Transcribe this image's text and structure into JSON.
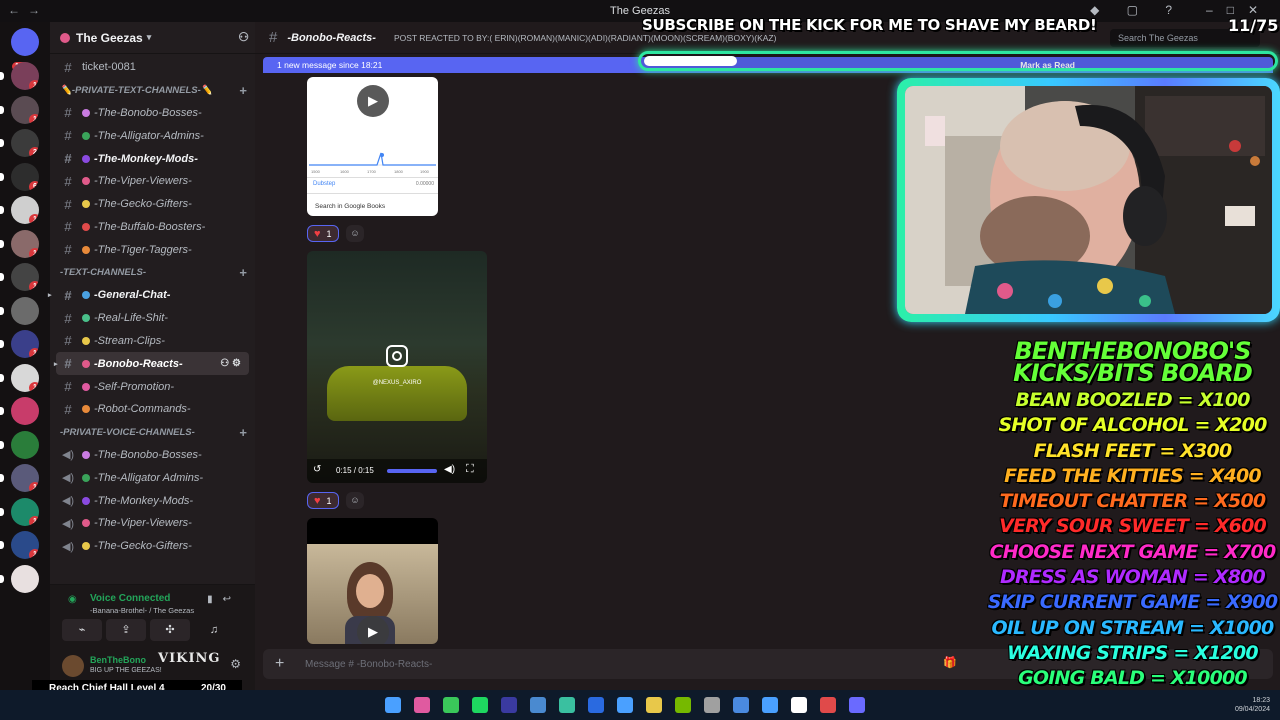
{
  "window": {
    "title": "The Geezas"
  },
  "rail": {
    "home_badge": "116",
    "servers": [
      {
        "color": "#7a3f5a",
        "badge": "1"
      },
      {
        "color": "#5a4b52",
        "badge": "1"
      },
      {
        "color": "#3b3b3b",
        "badge": "2"
      },
      {
        "color": "#2d2d2d",
        "badge": "6"
      },
      {
        "color": "#cfcfcf",
        "badge": "1"
      },
      {
        "color": "#8a6a6a",
        "badge": "1"
      },
      {
        "color": "#444444",
        "badge": "1"
      },
      {
        "color": "#6b6b6b",
        "badge": ""
      },
      {
        "color": "#3a3f8a",
        "badge": "1"
      },
      {
        "color": "#d8d8d8",
        "badge": "1"
      },
      {
        "color": "#c83c6a",
        "badge": ""
      },
      {
        "color": "#2a7d3a",
        "badge": ""
      },
      {
        "color": "#5a5a7a",
        "badge": "1"
      },
      {
        "color": "#1c8a6a",
        "badge": "1"
      },
      {
        "color": "#2a4a8a",
        "badge": "1"
      },
      {
        "color": "#e8e0e0",
        "badge": ""
      }
    ]
  },
  "sidebar": {
    "guild_name": "The Geezas",
    "items": [
      {
        "kind": "text",
        "label": "ticket-0081",
        "emoji": "",
        "bold": false,
        "italic_off": true
      },
      {
        "kind": "cat",
        "label": "✏️-PRIVATE-TEXT-CHANNELS-✏️"
      },
      {
        "kind": "text",
        "label": "-The-Bonobo-Bosses-",
        "emoji": "#c97be0"
      },
      {
        "kind": "text",
        "label": "-The-Alligator-Admins-",
        "emoji": "#3aa35a"
      },
      {
        "kind": "text",
        "label": "-The-Monkey-Mods-",
        "emoji": "#8a4ae0",
        "bold": true
      },
      {
        "kind": "text",
        "label": "-The-Viper-Viewers-",
        "emoji": "#e05a8a"
      },
      {
        "kind": "text",
        "label": "-The-Gecko-Gifters-",
        "emoji": "#e8c84a"
      },
      {
        "kind": "text",
        "label": "-The-Buffalo-Boosters-",
        "emoji": "#e04a4a"
      },
      {
        "kind": "text",
        "label": "-The-Tiger-Taggers-",
        "emoji": "#e88a3a"
      },
      {
        "kind": "cat",
        "label": "-TEXT-CHANNELS-"
      },
      {
        "kind": "text",
        "label": "-General-Chat-",
        "emoji": "#4aa0e0",
        "bold": true,
        "arrow": true
      },
      {
        "kind": "text",
        "label": "-Real-Life-Shit-",
        "emoji": "#4ac08a"
      },
      {
        "kind": "text",
        "label": "-Stream-Clips-",
        "emoji": "#e8c84a"
      },
      {
        "kind": "active",
        "label": "-Bonobo-Reacts-",
        "emoji": "#e05a8a",
        "arrow": true
      },
      {
        "kind": "text",
        "label": "-Self-Promotion-",
        "emoji": "#e05aa0"
      },
      {
        "kind": "text",
        "label": "-Robot-Commands-",
        "emoji": "#e88a3a"
      },
      {
        "kind": "cat",
        "label": "-PRIVATE-VOICE-CHANNELS-"
      },
      {
        "kind": "voice",
        "label": "-The-Bonobo-Bosses-",
        "emoji": "#c97be0"
      },
      {
        "kind": "voice",
        "label": "-The-Alligator Admins-",
        "emoji": "#3aa35a"
      },
      {
        "kind": "voice",
        "label": "-The-Monkey-Mods-",
        "emoji": "#8a4ae0"
      },
      {
        "kind": "voice",
        "label": "-The-Viper-Viewers-",
        "emoji": "#e05a8a"
      },
      {
        "kind": "voice",
        "label": "-The-Gecko-Gifters-",
        "emoji": "#e8c84a"
      }
    ],
    "voice": {
      "title": "Voice Connected",
      "subtitle": "-Banana-Brothel- / The Geezas"
    },
    "user": {
      "name": "BenTheBono",
      "status": "BIG UP THE GEEZAS!",
      "logo": "VIKING"
    }
  },
  "goal": {
    "label": "Reach Chief Hall Level 4",
    "count": "20/30",
    "progress": 0.6667
  },
  "chat": {
    "channel": "-Bonobo-Reacts-",
    "topic": "POST REACTED TO BY:( ERIN)(ROMAN)(MANIC)(ADI)(RADIANT)(MOON)(SCREAM)(BOXY)(KAZ)",
    "search_placeholder": "Search The Geezas",
    "new_messages": "1 new message since 18:21",
    "mark_read": "Mark as Read",
    "input_placeholder": "Message # -Bonobo-Reacts-",
    "attachments": {
      "books": {
        "ticks": [
          "1500",
          "1600",
          "1700",
          "1800",
          "1900"
        ],
        "legend": "Dubstep",
        "legend_value": "0.00000",
        "link": "Search in Google Books",
        "reaction_count": "1"
      },
      "video": {
        "handle": "@NEXUS_AXIRO",
        "time": "0:15 / 0:15",
        "reaction_count": "1"
      }
    }
  },
  "overlay": {
    "banner": "SUBSCRIBE ON THE KICK FOR ME TO SHAVE MY BEARD!",
    "sub_count": "11/75",
    "sub_progress": 0.1467,
    "board_title": "BENTHEBONOBO'S KICKS/BITS BOARD",
    "board_items": [
      {
        "text": "BEAN BOOZLED = X100",
        "color": "#c6ff2e"
      },
      {
        "text": "SHOT OF ALCOHOL = X200",
        "color": "#e6ff26"
      },
      {
        "text": "FLASH FEET = X300",
        "color": "#ffe22a"
      },
      {
        "text": "FEED THE KITTIES = X400",
        "color": "#ffb020"
      },
      {
        "text": "TIMEOUT CHATTER = X500",
        "color": "#ff6a1e"
      },
      {
        "text": "VERY SOUR SWEET = X600",
        "color": "#ff2a2a"
      },
      {
        "text": "CHOOSE NEXT GAME = X700",
        "color": "#ff2ac8"
      },
      {
        "text": "DRESS AS WOMAN = X800",
        "color": "#b02aff"
      },
      {
        "text": "SKIP CURRENT GAME = X900",
        "color": "#3a6aff"
      },
      {
        "text": "OIL UP ON STREAM = X1000",
        "color": "#2ab8ff"
      },
      {
        "text": "WAXING STRIPS = X1200",
        "color": "#2affe0"
      },
      {
        "text": "GOING BALD = X10000",
        "color": "#2aff7a"
      }
    ]
  },
  "taskbar": {
    "time": "18:23",
    "date": "09/04/2024",
    "apps": [
      "#4aa0ff",
      "#e05aa0",
      "#3ac85a",
      "#1ed760",
      "#3a3aa0",
      "#4a8ad0",
      "#3ac0a0",
      "#2a6ae0",
      "#4aa0ff",
      "#e8c84a",
      "#76b900",
      "#a0a0a0",
      "#4a8ae0",
      "#4aa0ff",
      "#ffffff",
      "#e04a4a",
      "#6a6aff"
    ]
  }
}
